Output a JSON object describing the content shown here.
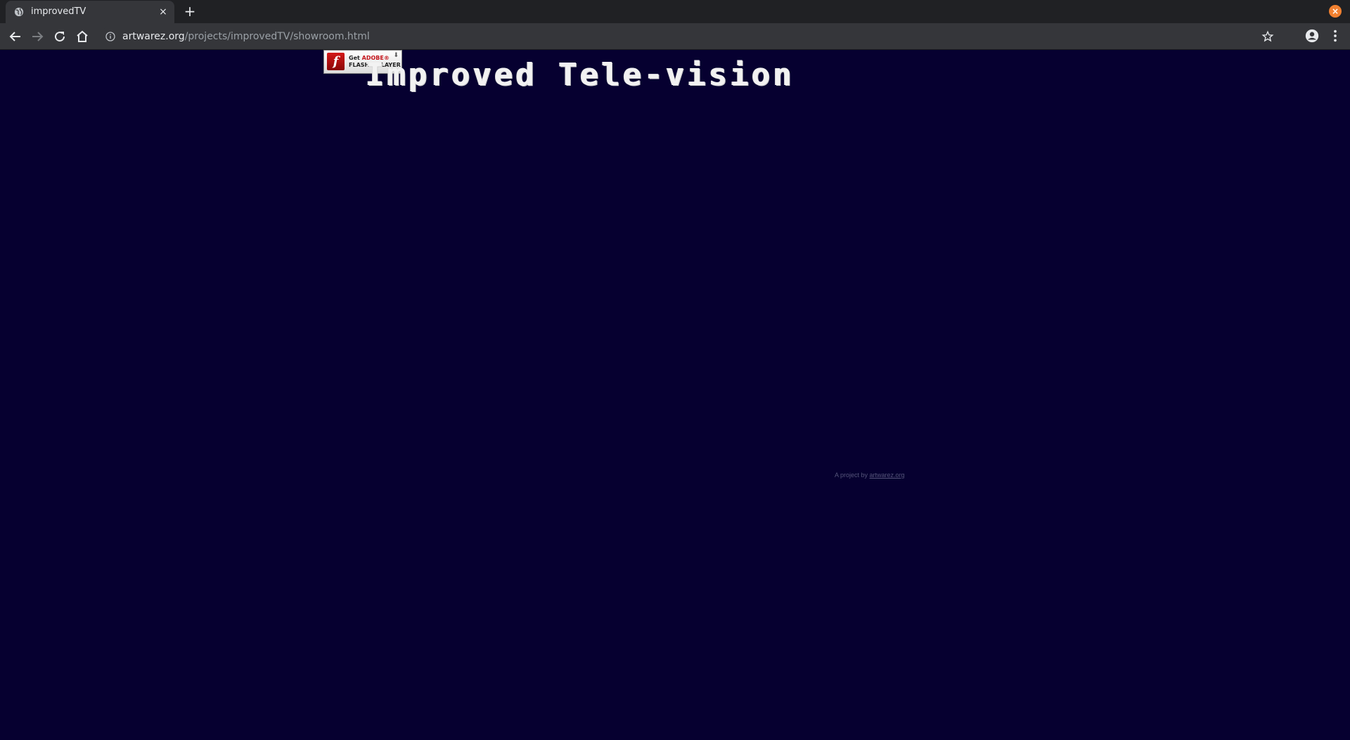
{
  "browser": {
    "tab_title": "improvedTV",
    "tab_close_symbol": "×",
    "new_tab_symbol": "+",
    "window_close_symbol": "×",
    "url_host": "artwarez.org",
    "url_path": "/projects/improvedTV/showroom.html",
    "accent_color": "#f08030"
  },
  "page": {
    "background_color": "#060030",
    "title": "Improved Tele-vision",
    "flash_badge": {
      "get_text": "Get",
      "brand_text": "ADOBE®",
      "product_text": "FLASH® PLAYER",
      "logo_glyph": "f"
    },
    "credit": {
      "prefix": "A project by",
      "link_text": "artwarez.org"
    }
  }
}
